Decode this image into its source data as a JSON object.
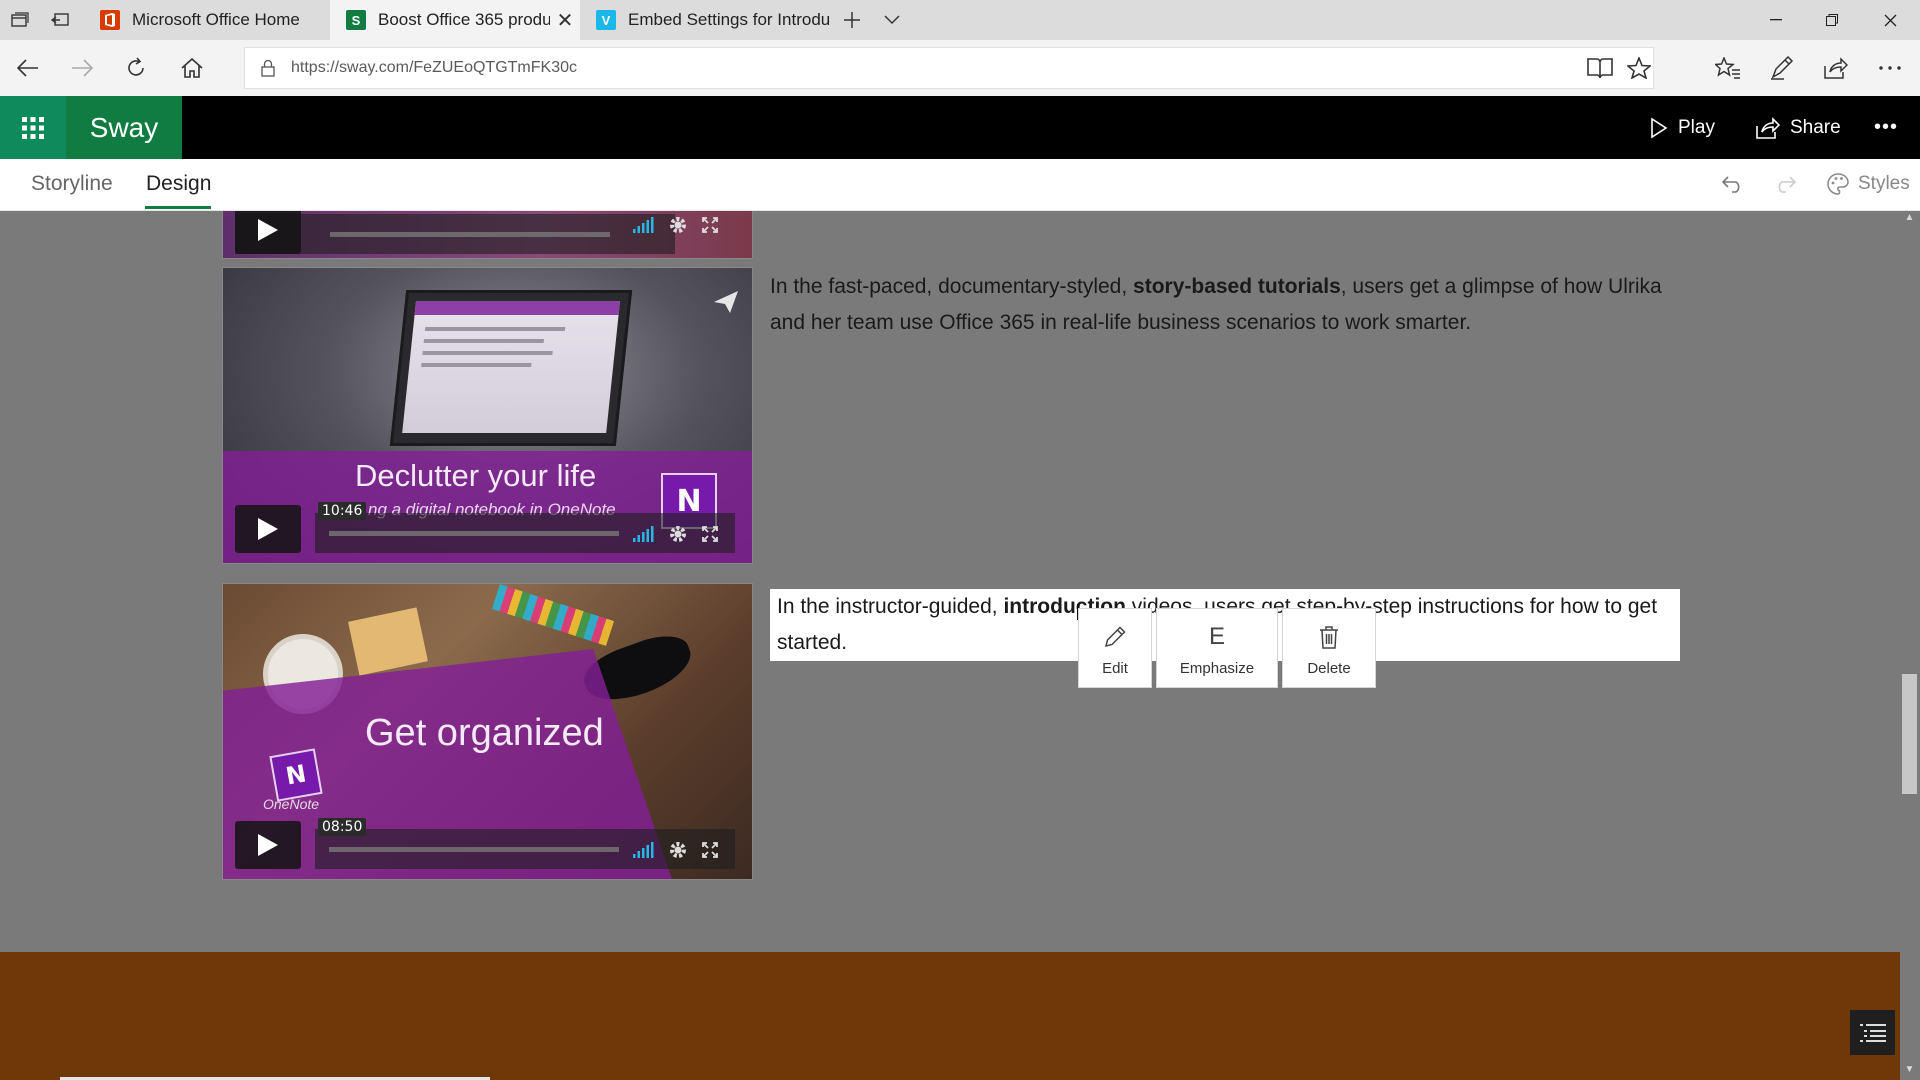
{
  "browser": {
    "tabs": [
      {
        "title": "Microsoft Office Home",
        "favicon": "office-icon",
        "favicon_color": "#d83b01"
      },
      {
        "title": "Boost Office 365 produ",
        "favicon": "sway-icon",
        "favicon_color": "#107c41",
        "close": "✕"
      },
      {
        "title": "Embed Settings for Introdu",
        "favicon": "vimeo-icon",
        "favicon_color": "#1ab7ea"
      }
    ],
    "url": "https://sway.com/FeZUEoQTGTmFK30c"
  },
  "app": {
    "brand": "Sway",
    "play_label": "Play",
    "share_label": "Share",
    "more_label": "•••"
  },
  "modes": {
    "storyline": "Storyline",
    "design": "Design",
    "styles": "Styles"
  },
  "content": {
    "video1": {
      "title": "Declutter your life",
      "subtitle": "ng a digital notebook in OneNote",
      "duration": "10:46",
      "logo_letter": "N"
    },
    "video2": {
      "title": "Get organized",
      "logo_text": "OneNote",
      "logo_letter": "N",
      "duration": "08:50"
    },
    "text1": {
      "before": "In the fast-paced, documentary-styled, ",
      "bold": "story-based tutorials",
      "after": ", users get a glimpse of how Ulrika and her team use Office 365 in real-life business scenarios to work smarter."
    },
    "text2": {
      "before": "In the instructor-guided, ",
      "bold": "introduction",
      "after": " videos, users get step-by-step instructions for how to get started."
    }
  },
  "popup": {
    "edit": "Edit",
    "emphasize_glyph": "E",
    "emphasize": "Emphasize",
    "delete": "Delete"
  },
  "colors": {
    "accent": "#107c41",
    "footer": "#6e3808",
    "video_band": "#821e96"
  }
}
